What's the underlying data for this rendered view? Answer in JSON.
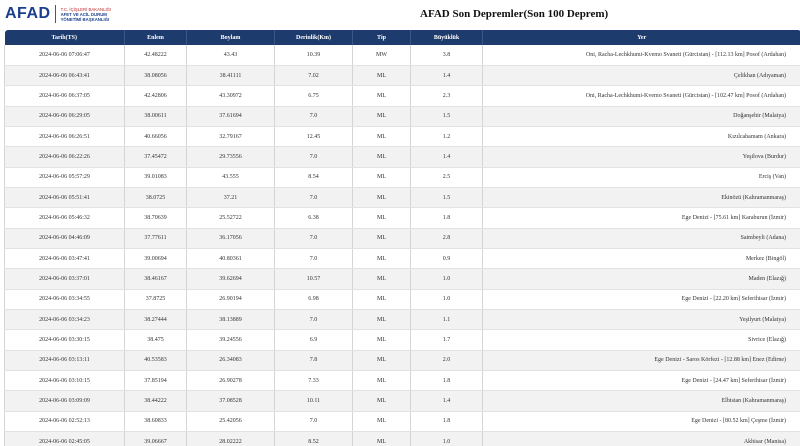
{
  "header": {
    "logo_text": "AFAD",
    "logo_sub_lines": [
      "T.C. İÇİŞLERİ BAKANLIĞI",
      "AFET VE ACİL DURUM",
      "YÖNETİMİ BAŞKANLIĞI"
    ],
    "title": "AFAD Son Depremler(Son 100 Deprem)"
  },
  "colors": {
    "header_bg": "#1e3b6e",
    "brand_blue": "#1a3f8f",
    "brand_red": "#c1272d"
  },
  "table": {
    "columns": [
      "Tarih(TS)",
      "Enlem",
      "Boylam",
      "Derinlik(Km)",
      "Tip",
      "Büyüklük",
      "Yer"
    ],
    "rows": [
      [
        "2024-06-06 07:06:47",
        "42.48222",
        "43.43",
        "10.39",
        "MW",
        "3.8",
        "Oni, Racha-Lechkhumi-Kvemo Svaneti (Gürcistan) - [112.13 km] Posof (Ardahan)"
      ],
      [
        "2024-06-06 06:43:41",
        "38.08056",
        "38.41111",
        "7.02",
        "ML",
        "1.4",
        "Çelikhan (Adıyaman)"
      ],
      [
        "2024-06-06 06:37:05",
        "42.42806",
        "43.30972",
        "6.75",
        "ML",
        "2.3",
        "Oni, Racha-Lechkhumi-Kvemo Svaneti (Gürcistan) - [102.47 km] Posof (Ardahan)"
      ],
      [
        "2024-06-06 06:29:05",
        "38.00611",
        "37.61694",
        "7.0",
        "ML",
        "1.5",
        "Doğanşehir (Malatya)"
      ],
      [
        "2024-06-06 06:26:51",
        "40.66056",
        "32.79167",
        "12.45",
        "ML",
        "1.2",
        "Kızılcahamam (Ankara)"
      ],
      [
        "2024-06-06 06:22:26",
        "37.45472",
        "29.73556",
        "7.0",
        "ML",
        "1.4",
        "Yeşilova (Burdur)"
      ],
      [
        "2024-06-06 05:57:29",
        "39.01083",
        "43.555",
        "8.54",
        "ML",
        "2.5",
        "Erciş (Van)"
      ],
      [
        "2024-06-06 05:51:41",
        "38.0725",
        "37.21",
        "7.0",
        "ML",
        "1.5",
        "Ekinözü (Kahramanmaraş)"
      ],
      [
        "2024-06-06 05:46:32",
        "38.70639",
        "25.52722",
        "6.38",
        "ML",
        "1.8",
        "Ege Denizi - [75.61 km] Karaburun (İzmir)"
      ],
      [
        "2024-06-06 04:46:09",
        "37.77611",
        "36.17056",
        "7.0",
        "ML",
        "2.8",
        "Saimbeyli (Adana)"
      ],
      [
        "2024-06-06 03:47:41",
        "39.00694",
        "40.80361",
        "7.0",
        "ML",
        "0.9",
        "Merkez (Bingöl)"
      ],
      [
        "2024-06-06 03:37:01",
        "38.46167",
        "39.62694",
        "10.57",
        "ML",
        "1.0",
        "Maden (Elazığ)"
      ],
      [
        "2024-06-06 03:34:55",
        "37.8725",
        "26.90194",
        "6.98",
        "ML",
        "1.0",
        "Ege Denizi - [22.20 km] Seferihisar (İzmir)"
      ],
      [
        "2024-06-06 03:34:23",
        "38.27444",
        "38.13889",
        "7.0",
        "ML",
        "1.1",
        "Yeşilyurt (Malatya)"
      ],
      [
        "2024-06-06 03:30:15",
        "38.475",
        "39.24556",
        "6.9",
        "ML",
        "1.7",
        "Sivrice (Elazığ)"
      ],
      [
        "2024-06-06 03:13:11",
        "40.53583",
        "26.34083",
        "7.8",
        "ML",
        "2.0",
        "Ege Denizi - Saros Körfezi - [12.88 km] Enez (Edirne)"
      ],
      [
        "2024-06-06 03:10:15",
        "37.85194",
        "26.90278",
        "7.33",
        "ML",
        "1.8",
        "Ege Denizi - [24.47 km] Seferihisar (İzmir)"
      ],
      [
        "2024-06-06 03:09:09",
        "38.44222",
        "37.08528",
        "10.11",
        "ML",
        "1.4",
        "Elbistan (Kahramanmaraş)"
      ],
      [
        "2024-06-06 02:52:13",
        "38.60833",
        "25.42056",
        "7.0",
        "ML",
        "1.8",
        "Ege Denizi - [80.52 km] Çeşme (İzmir)"
      ],
      [
        "2024-06-06 02:45:05",
        "39.06667",
        "28.02222",
        "8.52",
        "ML",
        "1.0",
        "Akhisar (Manisa)"
      ]
    ]
  }
}
